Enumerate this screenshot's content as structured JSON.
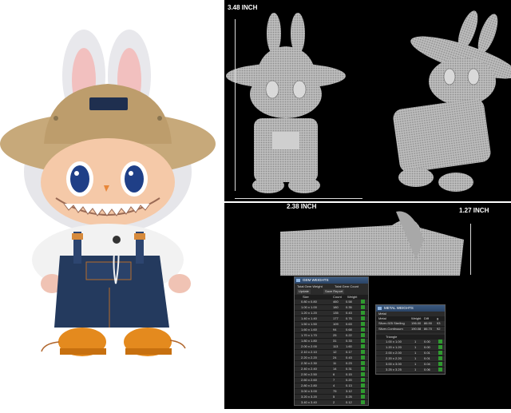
{
  "dimensions": {
    "height": "3.48 INCH",
    "width": "2.38 INCH",
    "depth": "1.27 INCH"
  },
  "gem_panel": {
    "title": "GEM WEIGHTS",
    "total_label": "Total Gem Weight",
    "count_label": "Total Gem Count",
    "update_label": "Update",
    "save_label": "Save Report",
    "headers": [
      "Size",
      "Count",
      "Weight"
    ],
    "rows": [
      [
        "0.80 x 0.80",
        "460",
        "0.58"
      ],
      [
        "1.00 x 1.00",
        "180",
        "0.35"
      ],
      [
        "1.20 x 1.20",
        "135",
        "0.43"
      ],
      [
        "1.40 x 1.40",
        "177",
        "0.75"
      ],
      [
        "1.50 x 1.50",
        "109",
        "0.63"
      ],
      [
        "1.60 x 1.60",
        "94",
        "0.68"
      ],
      [
        "1.70 x 1.70",
        "25",
        "0.22"
      ],
      [
        "1.80 x 1.80",
        "31",
        "0.33"
      ],
      [
        "2.00 x 2.00",
        "113",
        "1.60"
      ],
      [
        "2.10 x 2.10",
        "12",
        "0.17"
      ],
      [
        "2.20 x 2.20",
        "24",
        "0.43"
      ],
      [
        "2.30 x 2.30",
        "11",
        "0.23"
      ],
      [
        "2.40 x 2.40",
        "14",
        "0.31"
      ],
      [
        "2.50 x 2.50",
        "6",
        "0.15"
      ],
      [
        "2.60 x 2.60",
        "7",
        "0.20"
      ],
      [
        "2.80 x 2.80",
        "4",
        "0.13"
      ],
      [
        "3.00 x 3.00",
        "75",
        "3.12"
      ],
      [
        "3.20 x 3.20",
        "5",
        "0.25"
      ],
      [
        "3.40 x 3.40",
        "2",
        "0.12"
      ],
      [
        "3.60 x 3.60",
        "2",
        "0.14"
      ],
      [
        "3.80 x 3.80",
        "1",
        "0.08"
      ],
      [
        "4.00 x 4.00",
        "1",
        "0.09"
      ]
    ]
  },
  "metal_panel": {
    "title": "METAL WEIGHTS",
    "subtitle": "Metal",
    "headers": [
      "Metal",
      "Weight",
      "Diff",
      "g"
    ],
    "metals": [
      [
        "Silver-925 Sterling",
        "196.00",
        "86.90",
        "93"
      ],
      [
        "Silver-Continuum",
        "190.08",
        "86.70",
        "92"
      ]
    ],
    "gem_label": "Triangle",
    "gem_rows": [
      [
        "1.00 x 1.00",
        "1",
        "0.00"
      ],
      [
        "1.20 x 1.20",
        "1",
        "0.00"
      ],
      [
        "2.00 x 2.00",
        "1",
        "0.01"
      ],
      [
        "2.20 x 2.20",
        "1",
        "0.01"
      ],
      [
        "3.00 x 3.00",
        "1",
        "0.04"
      ],
      [
        "3.25 x 3.25",
        "1",
        "0.06"
      ]
    ]
  },
  "colors": {
    "background_right": "#000000",
    "hat": "#c7a97a",
    "overalls": "#243a5e",
    "boots": "#e48a1e",
    "fur": "#e6e6ea",
    "skin": "#f5c9a8",
    "eye": "#1f3f87",
    "mesh": "#bdbdbd",
    "check": "#2f9a2f"
  }
}
